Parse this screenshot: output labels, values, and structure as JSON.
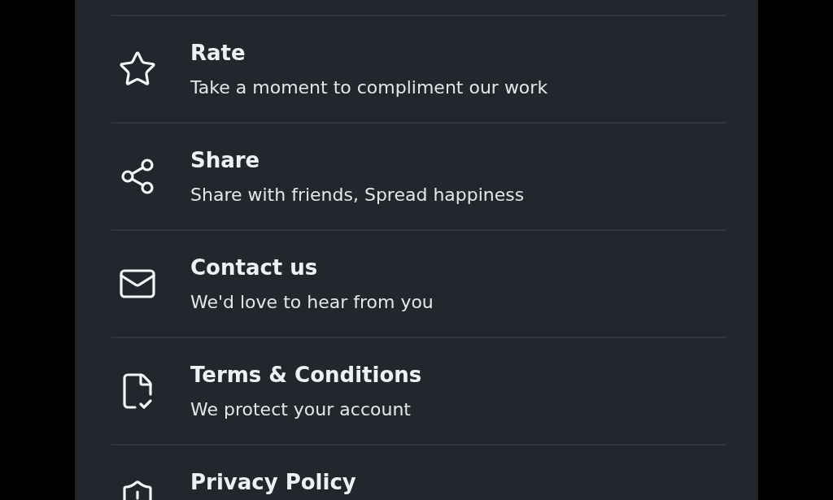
{
  "menu": [
    {
      "kind": "star",
      "title": "Rate",
      "subtitle": "Take a moment to compliment our work"
    },
    {
      "kind": "share",
      "title": "Share",
      "subtitle": "Share with friends, Spread happiness"
    },
    {
      "kind": "mail",
      "title": "Contact us",
      "subtitle": "We'd love to hear from you"
    },
    {
      "kind": "document",
      "title": "Terms & Conditions",
      "subtitle": "We protect your account"
    },
    {
      "kind": "shield",
      "title": "Privacy Policy"
    }
  ]
}
